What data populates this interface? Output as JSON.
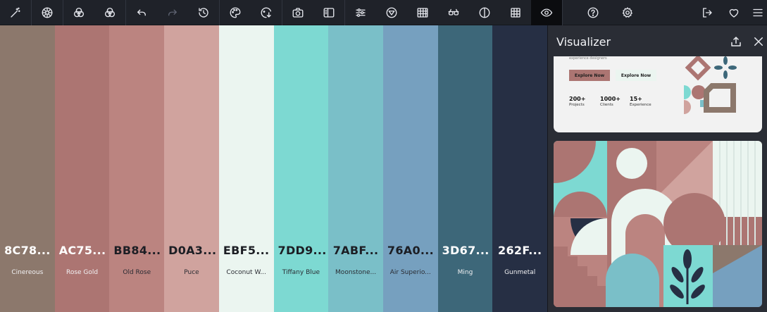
{
  "toolbar": {
    "left_icons": [
      "magic-wand-icon",
      "color-wheel-icon",
      "color-blend-icon",
      "color-blend-alt-icon",
      "undo-icon",
      "redo-icon",
      "history-icon",
      "palette-icon",
      "export-palette-icon",
      "camera-icon",
      "sidebar-panel-icon",
      "sliders-icon",
      "filter-icon",
      "grid-table-icon",
      "glasses-icon",
      "contrast-icon",
      "grid-icon",
      "eye-icon"
    ],
    "right_icons": [
      "gear-icon",
      "help-icon",
      "logout-icon",
      "heart-icon",
      "menu-icon"
    ]
  },
  "palette": [
    {
      "hex": "8C78...",
      "name": "Cinereous",
      "color": "#8c786c",
      "tone": "dark"
    },
    {
      "hex": "AC75...",
      "name": "Rose Gold",
      "color": "#ac7572",
      "tone": "dark"
    },
    {
      "hex": "BB84...",
      "name": "Old Rose",
      "color": "#bb8480",
      "tone": "light"
    },
    {
      "hex": "D0A3...",
      "name": "Puce",
      "color": "#d0a39e",
      "tone": "light"
    },
    {
      "hex": "EBF5...",
      "name": "Coconut W...",
      "color": "#ebf5f0",
      "tone": "light"
    },
    {
      "hex": "7DD9...",
      "name": "Tiffany Blue",
      "color": "#7dd9d2",
      "tone": "light"
    },
    {
      "hex": "7ABF...",
      "name": "Moonstone...",
      "color": "#7abfc8",
      "tone": "light"
    },
    {
      "hex": "76A0...",
      "name": "Air Superio...",
      "color": "#76a0bf",
      "tone": "light"
    },
    {
      "hex": "3D67...",
      "name": "Ming",
      "color": "#3d6779",
      "tone": "dark"
    },
    {
      "hex": "262F...",
      "name": "Gunmetal",
      "color": "#262f44",
      "tone": "dark"
    }
  ],
  "visualizer": {
    "title": "Visualizer",
    "preview_text": "experience designers",
    "button_primary": "Explore Now",
    "button_secondary": "Explore Now",
    "stats": [
      {
        "number": "200+",
        "label": "Projects"
      },
      {
        "number": "1000+",
        "label": "Clients"
      },
      {
        "number": "15+",
        "label": "Experience"
      }
    ]
  }
}
